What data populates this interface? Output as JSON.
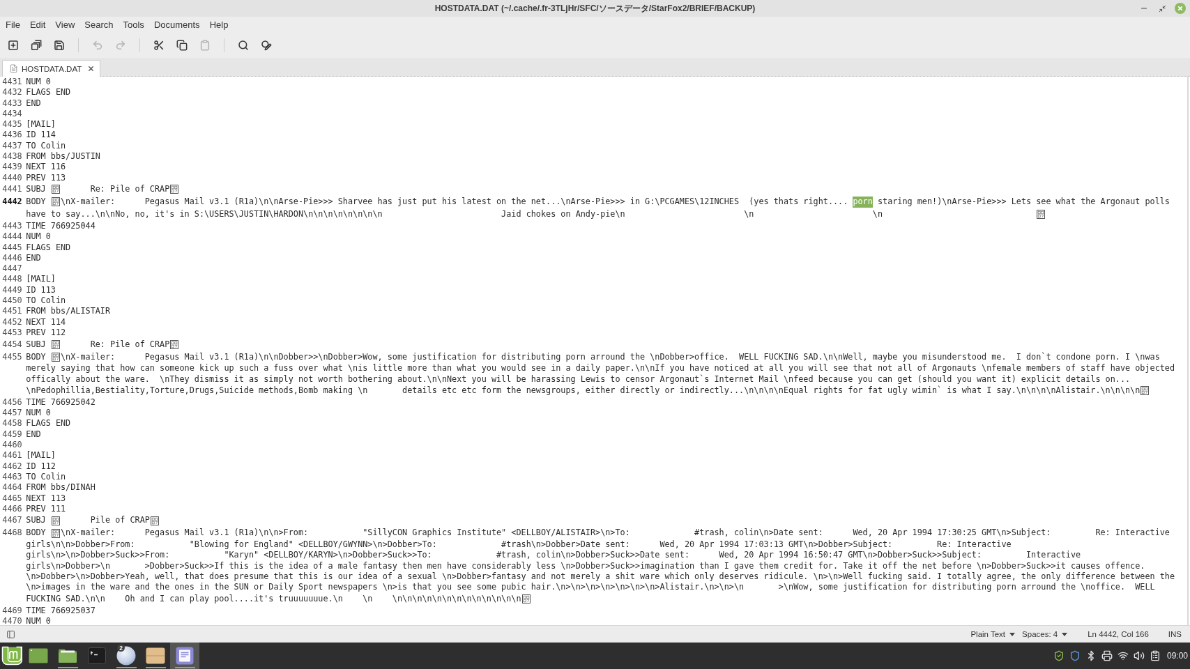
{
  "window": {
    "title": "HOSTDATA.DAT (~/.cache/.fr-3TLjHr/SFC/ソースデータ/StarFox2/BRIEF/BACKUP)"
  },
  "menu_bar": [
    {
      "label": "File"
    },
    {
      "label": "Edit"
    },
    {
      "label": "View"
    },
    {
      "label": "Search"
    },
    {
      "label": "Tools"
    },
    {
      "label": "Documents"
    },
    {
      "label": "Help"
    }
  ],
  "toolbar": [
    {
      "kind": "new",
      "disabled": false
    },
    {
      "kind": "open",
      "disabled": false
    },
    {
      "kind": "save",
      "disabled": false
    },
    {
      "kind": "separator"
    },
    {
      "kind": "undo",
      "disabled": true
    },
    {
      "kind": "redo",
      "disabled": true
    },
    {
      "kind": "separator"
    },
    {
      "kind": "cut",
      "disabled": false
    },
    {
      "kind": "copy",
      "disabled": false
    },
    {
      "kind": "paste",
      "disabled": true
    },
    {
      "kind": "separator"
    },
    {
      "kind": "find",
      "disabled": false
    },
    {
      "kind": "replace",
      "disabled": false
    }
  ],
  "tabs": [
    {
      "label": "HOSTDATA.DAT",
      "selected": true
    }
  ],
  "editor": {
    "lines": [
      {
        "number": "4431",
        "current": false,
        "rows": [
          [
            {
              "kind": "text",
              "text": "NUM 0"
            }
          ]
        ]
      },
      {
        "number": "4432",
        "current": false,
        "rows": [
          [
            {
              "kind": "text",
              "text": "FLAGS END"
            }
          ]
        ]
      },
      {
        "number": "4433",
        "current": false,
        "rows": [
          [
            {
              "kind": "text",
              "text": "END"
            }
          ]
        ]
      },
      {
        "number": "4434",
        "current": false
      },
      {
        "number": "4435",
        "current": false,
        "rows": [
          [
            {
              "kind": "text",
              "text": "[MAIL]"
            }
          ]
        ]
      },
      {
        "number": "4436",
        "current": false,
        "rows": [
          [
            {
              "kind": "text",
              "text": "ID 114"
            }
          ]
        ]
      },
      {
        "number": "4437",
        "current": false,
        "rows": [
          [
            {
              "kind": "text",
              "text": "TO Colin"
            }
          ]
        ]
      },
      {
        "number": "4438",
        "current": false,
        "rows": [
          [
            {
              "kind": "text",
              "text": "FROM bbs/JUSTIN"
            }
          ]
        ]
      },
      {
        "number": "4439",
        "current": false,
        "rows": [
          [
            {
              "kind": "text",
              "text": "NEXT 116"
            }
          ]
        ]
      },
      {
        "number": "4440",
        "current": false,
        "rows": [
          [
            {
              "kind": "text",
              "text": "PREV 113"
            }
          ]
        ]
      },
      {
        "number": "4441",
        "current": false,
        "rows": [
          [
            {
              "kind": "text",
              "text": "SUBJ "
            },
            {
              "kind": "control"
            },
            {
              "kind": "text",
              "text": "      Re: Pile of CRAP"
            },
            {
              "kind": "control"
            }
          ]
        ]
      },
      {
        "number": "4442",
        "current": true,
        "rows": [
          [
            {
              "kind": "text",
              "text": "BODY "
            },
            {
              "kind": "control"
            },
            {
              "kind": "text",
              "text": "\\nX-mailer:      Pegasus Mail v3.1 (R1a)\\n\\nArse-Pie>>> Sharvee has just put his latest on the net...\\nArse-Pie>>> in G:\\PCGAMES\\12INCHES  (yes thats right.... "
            },
            {
              "kind": "selection",
              "text": "porn"
            },
            {
              "kind": "text",
              "text": " staring men!)\\nArse-Pie>>> Lets see what the Argonaut polls"
            }
          ],
          [
            {
              "kind": "text",
              "text": "have to say...\\n\\nNo, no, it's in S:\\USERS\\JUSTIN\\HARDON\\n\\n\\n\\n\\n\\n\\n\\n                        Jaid chokes on Andy-pie\\n                        \\n                        \\n                               "
            },
            {
              "kind": "control"
            }
          ]
        ]
      },
      {
        "number": "4443",
        "current": false,
        "rows": [
          [
            {
              "kind": "text",
              "text": "TIME 766925044"
            }
          ]
        ]
      },
      {
        "number": "4444",
        "current": false,
        "rows": [
          [
            {
              "kind": "text",
              "text": "NUM 0"
            }
          ]
        ]
      },
      {
        "number": "4445",
        "current": false,
        "rows": [
          [
            {
              "kind": "text",
              "text": "FLAGS END"
            }
          ]
        ]
      },
      {
        "number": "4446",
        "current": false,
        "rows": [
          [
            {
              "kind": "text",
              "text": "END"
            }
          ]
        ]
      },
      {
        "number": "4447",
        "current": false
      },
      {
        "number": "4448",
        "current": false,
        "rows": [
          [
            {
              "kind": "text",
              "text": "[MAIL]"
            }
          ]
        ]
      },
      {
        "number": "4449",
        "current": false,
        "rows": [
          [
            {
              "kind": "text",
              "text": "ID 113"
            }
          ]
        ]
      },
      {
        "number": "4450",
        "current": false,
        "rows": [
          [
            {
              "kind": "text",
              "text": "TO Colin"
            }
          ]
        ]
      },
      {
        "number": "4451",
        "current": false,
        "rows": [
          [
            {
              "kind": "text",
              "text": "FROM bbs/ALISTAIR"
            }
          ]
        ]
      },
      {
        "number": "4452",
        "current": false,
        "rows": [
          [
            {
              "kind": "text",
              "text": "NEXT 114"
            }
          ]
        ]
      },
      {
        "number": "4453",
        "current": false,
        "rows": [
          [
            {
              "kind": "text",
              "text": "PREV 112"
            }
          ]
        ]
      },
      {
        "number": "4454",
        "current": false,
        "rows": [
          [
            {
              "kind": "text",
              "text": "SUBJ "
            },
            {
              "kind": "control"
            },
            {
              "kind": "text",
              "text": "      Re: Pile of CRAP"
            },
            {
              "kind": "control"
            }
          ]
        ]
      },
      {
        "number": "4455",
        "current": false,
        "rows": [
          [
            {
              "kind": "text",
              "text": "BODY "
            },
            {
              "kind": "control"
            },
            {
              "kind": "text",
              "text": "\\nX-mailer:      Pegasus Mail v3.1 (R1a)\\n\\nDobber>>\\nDobber>Wow, some justification for distributing porn arround the \\nDobber>office.  WELL FUCKING SAD.\\n\\nWell, maybe you misunderstood me.  I don`t condone porn. I \\nwas"
            }
          ],
          [
            {
              "kind": "text",
              "text": "merely saying that how can someone kick up such a fuss over what \\nis little more than what you would see in a daily paper.\\n\\nIf you have noticed at all you will see that not all of Argonauts \\nfemale members of staff have objected"
            }
          ],
          [
            {
              "kind": "text",
              "text": "offically about the ware.  \\nThey dismiss it as simply not worth bothering about.\\n\\nNext you will be harassing Lewis to censor Argonaut`s Internet Mail \\nfeed because you can get (should you want it) explicit details on..."
            }
          ],
          [
            {
              "kind": "text",
              "text": "\\nPedophillia,Bestiality,Torture,Drugs,Suicide methods,Bomb making \\n       details etc etc form the newsgroups, either directly or indirectly...\\n\\n\\n\\nEqual rights for fat ugly wimin` is what I say.\\n\\n\\n\\nAlistair.\\n\\n\\n\\n"
            },
            {
              "kind": "control"
            }
          ]
        ]
      },
      {
        "number": "4456",
        "current": false,
        "rows": [
          [
            {
              "kind": "text",
              "text": "TIME 766925042"
            }
          ]
        ]
      },
      {
        "number": "4457",
        "current": false,
        "rows": [
          [
            {
              "kind": "text",
              "text": "NUM 0"
            }
          ]
        ]
      },
      {
        "number": "4458",
        "current": false,
        "rows": [
          [
            {
              "kind": "text",
              "text": "FLAGS END"
            }
          ]
        ]
      },
      {
        "number": "4459",
        "current": false,
        "rows": [
          [
            {
              "kind": "text",
              "text": "END"
            }
          ]
        ]
      },
      {
        "number": "4460",
        "current": false
      },
      {
        "number": "4461",
        "current": false,
        "rows": [
          [
            {
              "kind": "text",
              "text": "[MAIL]"
            }
          ]
        ]
      },
      {
        "number": "4462",
        "current": false,
        "rows": [
          [
            {
              "kind": "text",
              "text": "ID 112"
            }
          ]
        ]
      },
      {
        "number": "4463",
        "current": false,
        "rows": [
          [
            {
              "kind": "text",
              "text": "TO Colin"
            }
          ]
        ]
      },
      {
        "number": "4464",
        "current": false,
        "rows": [
          [
            {
              "kind": "text",
              "text": "FROM bbs/DINAH"
            }
          ]
        ]
      },
      {
        "number": "4465",
        "current": false,
        "rows": [
          [
            {
              "kind": "text",
              "text": "NEXT 113"
            }
          ]
        ]
      },
      {
        "number": "4466",
        "current": false,
        "rows": [
          [
            {
              "kind": "text",
              "text": "PREV 111"
            }
          ]
        ]
      },
      {
        "number": "4467",
        "current": false,
        "rows": [
          [
            {
              "kind": "text",
              "text": "SUBJ "
            },
            {
              "kind": "control"
            },
            {
              "kind": "text",
              "text": "      Pile of CRAP"
            },
            {
              "kind": "control"
            }
          ]
        ]
      },
      {
        "number": "4468",
        "current": false,
        "rows": [
          [
            {
              "kind": "text",
              "text": "BODY "
            },
            {
              "kind": "control"
            },
            {
              "kind": "text",
              "text": "\\nX-mailer:      Pegasus Mail v3.1 (R1a)\\n\\n>From:           \"SillyCON Graphics Institute\" <DELLBOY/ALISTAIR>\\n>To:             #trash, colin\\n>Date sent:      Wed, 20 Apr 1994 17:30:25 GMT\\n>Subject:         Re: Interactive"
            }
          ],
          [
            {
              "kind": "text",
              "text": "girls\\n\\n>Dobber>From:           \"Blowing for England\" <DELLBOY/GWYNN>\\n>Dobber>To:             #trash\\n>Dobber>Date sent:      Wed, 20 Apr 1994 17:03:13 GMT\\n>Dobber>Subject:         Re: Interactive"
            }
          ],
          [
            {
              "kind": "text",
              "text": "girls\\n>\\n>Dobber>Suck>>From:           \"Karyn\" <DELLBOY/KARYN>\\n>Dobber>Suck>>To:             #trash, colin\\n>Dobber>Suck>>Date sent:      Wed, 20 Apr 1994 16:50:47 GMT\\n>Dobber>Suck>>Subject:         Interactive"
            }
          ],
          [
            {
              "kind": "text",
              "text": "girls\\n>Dobber>\\n       >Dobber>Suck>>If this is the idea of a male fantasy then men have considerably less \\n>Dobber>Suck>>imagination than I gave them credit for. Take it off the net before \\n>Dobber>Suck>>it causes offence."
            }
          ],
          [
            {
              "kind": "text",
              "text": "\\n>Dobber>\\n>Dobber>Yeah, well, that does presume that this is our idea of a sexual \\n>Dobber>fantasy and not merely a shit ware which only deserves ridicule. \\n>\\n>Well fucking said. I totally agree, the only difference between the"
            }
          ],
          [
            {
              "kind": "text",
              "text": "\\n>images in the ware and the ones in the SUN or Daily Sport newspapers \\n>is that you see some pubic hair.\\n>\\n>\\n>\\n>\\n>\\n>\\n>Alistair.\\n>\\n>\\n       >\\nWow, some justification for distributing porn arround the \\noffice.  WELL"
            }
          ],
          [
            {
              "kind": "text",
              "text": "FUCKING SAD.\\n\\n    Oh and I can play pool....it's truuuuuuue.\\n    \\n    \\n\\n\\n\\n\\n\\n\\n\\n\\n\\n\\n\\n\\n"
            },
            {
              "kind": "control"
            }
          ]
        ]
      },
      {
        "number": "4469",
        "current": false,
        "rows": [
          [
            {
              "kind": "text",
              "text": "TIME 766925037"
            }
          ]
        ]
      },
      {
        "number": "4470",
        "current": false,
        "rows": [
          [
            {
              "kind": "text",
              "text": "NUM 0"
            }
          ]
        ]
      }
    ]
  },
  "status_bar": {
    "language": "Plain Text",
    "indentation": "Spaces: 4",
    "position": "Ln 4442, Col 166",
    "mode": "INS"
  },
  "taskbar": {
    "launchers": [
      {
        "kind": "menu",
        "selected": false,
        "running": false
      },
      {
        "kind": "desktop",
        "selected": false,
        "running": false
      },
      {
        "kind": "folder",
        "selected": false,
        "running": true
      },
      {
        "kind": "terminal",
        "selected": false,
        "running": false
      },
      {
        "kind": "globe",
        "selected": false,
        "running": true,
        "badge": "2"
      },
      {
        "kind": "box",
        "selected": false,
        "running": true
      },
      {
        "kind": "editor",
        "selected": true,
        "running": true
      }
    ],
    "tray": [
      {
        "kind": "shield-check"
      },
      {
        "kind": "shield"
      },
      {
        "kind": "bluetooth"
      },
      {
        "kind": "printer"
      },
      {
        "kind": "network"
      },
      {
        "kind": "volume"
      },
      {
        "kind": "clipboard"
      }
    ],
    "clock": "09:00"
  }
}
